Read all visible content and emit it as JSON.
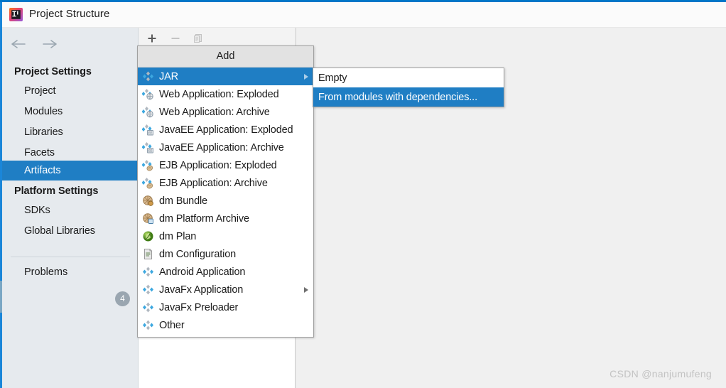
{
  "window": {
    "title": "Project Structure",
    "app_icon": "intellij-idea-icon"
  },
  "sidebar": {
    "back_icon": "arrow-left-icon",
    "forward_icon": "arrow-right-icon",
    "groups": [
      {
        "label": "Project Settings"
      },
      {
        "label": "Platform Settings"
      }
    ],
    "project_settings_items": [
      {
        "label": "Project",
        "selected": false
      },
      {
        "label": "Modules",
        "selected": false
      },
      {
        "label": "Libraries",
        "selected": false
      },
      {
        "label": "Facets",
        "selected": false
      },
      {
        "label": "Artifacts",
        "selected": true
      }
    ],
    "platform_settings_items": [
      {
        "label": "SDKs",
        "selected": false
      },
      {
        "label": "Global Libraries",
        "selected": false
      }
    ],
    "problems": {
      "label": "Problems",
      "count": "4"
    }
  },
  "toolbar": {
    "add_icon": "plus-icon",
    "remove_icon": "minus-icon",
    "copy_icon": "copy-icon"
  },
  "add_menu": {
    "header": "Add",
    "items": [
      {
        "label": "JAR",
        "icon": "jar-artifact-icon",
        "selected": true,
        "has_submenu": true
      },
      {
        "label": "Web Application: Exploded",
        "icon": "web-exploded-icon",
        "selected": false,
        "has_submenu": false
      },
      {
        "label": "Web Application: Archive",
        "icon": "web-archive-icon",
        "selected": false,
        "has_submenu": false
      },
      {
        "label": "JavaEE Application: Exploded",
        "icon": "javaee-exploded-icon",
        "selected": false,
        "has_submenu": false
      },
      {
        "label": "JavaEE Application: Archive",
        "icon": "javaee-archive-icon",
        "selected": false,
        "has_submenu": false
      },
      {
        "label": "EJB Application: Exploded",
        "icon": "ejb-exploded-icon",
        "selected": false,
        "has_submenu": false
      },
      {
        "label": "EJB Application: Archive",
        "icon": "ejb-archive-icon",
        "selected": false,
        "has_submenu": false
      },
      {
        "label": "dm Bundle",
        "icon": "dm-bundle-icon",
        "selected": false,
        "has_submenu": false
      },
      {
        "label": "dm Platform Archive",
        "icon": "dm-platform-archive-icon",
        "selected": false,
        "has_submenu": false
      },
      {
        "label": "dm Plan",
        "icon": "dm-plan-icon",
        "selected": false,
        "has_submenu": false
      },
      {
        "label": "dm Configuration",
        "icon": "dm-configuration-icon",
        "selected": false,
        "has_submenu": false
      },
      {
        "label": "Android Application",
        "icon": "android-application-icon",
        "selected": false,
        "has_submenu": false
      },
      {
        "label": "JavaFx Application",
        "icon": "javafx-application-icon",
        "selected": false,
        "has_submenu": true
      },
      {
        "label": "JavaFx Preloader",
        "icon": "javafx-preloader-icon",
        "selected": false,
        "has_submenu": false
      },
      {
        "label": "Other",
        "icon": "other-artifact-icon",
        "selected": false,
        "has_submenu": false
      }
    ]
  },
  "jar_submenu": {
    "items": [
      {
        "label": "Empty",
        "selected": false
      },
      {
        "label": "From modules with dependencies...",
        "selected": true
      }
    ]
  },
  "watermark": {
    "text": "CSDN @nanjumufeng"
  },
  "colors": {
    "accent": "#1f7ec4",
    "sidebar_bg": "#e6eaee",
    "menu_header_bg": "#e2e2e2",
    "content_bg": "#f0f0f0",
    "badge_bg": "#9aa6b0"
  }
}
